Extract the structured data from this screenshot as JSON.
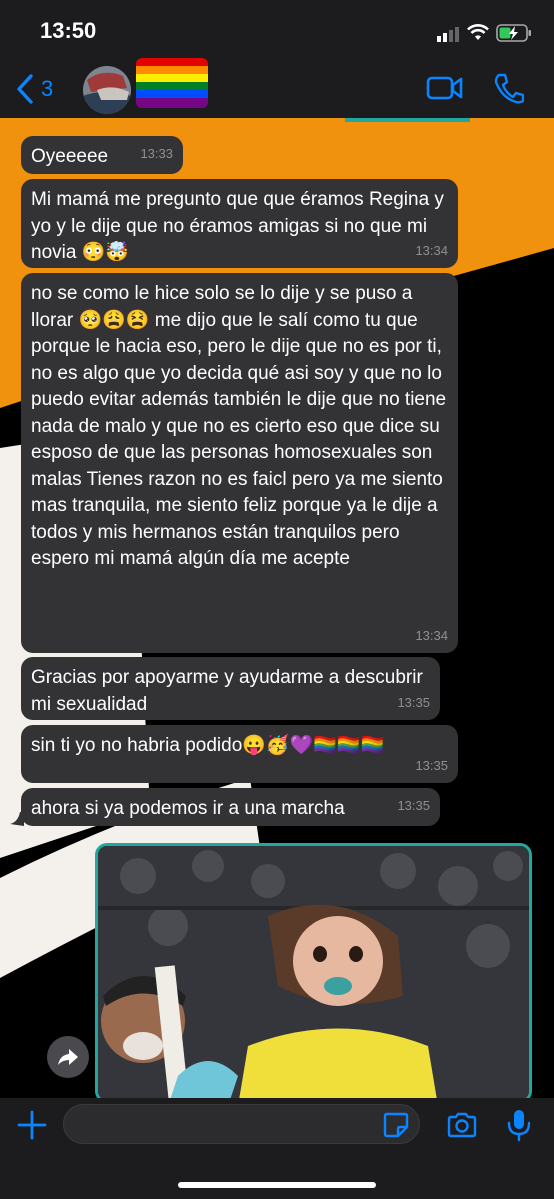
{
  "status": {
    "time": "13:50"
  },
  "header": {
    "back_count": "3"
  },
  "messages": [
    {
      "text": "Oyeeeee",
      "time": "13:33"
    },
    {
      "text": "Mi mamá me pregunto que que éramos Regina y yo y le dije que no éramos amigas si no que mi novia 😳🤯",
      "time": "13:34"
    },
    {
      "text": "no se como le hice solo se lo dije y se puso a llorar 🥺😩😫 me dijo que le salí como tu que porque le hacia eso, pero le dije que no es por ti, no es algo que yo decida qué asi soy y que no lo puedo evitar además también le dije que no tiene nada de malo y que no es cierto eso que dice su esposo de que las personas homosexuales son malas Tienes razon no es faicl pero ya me siento mas tranquila, me siento feliz porque ya le dije a todos y mis hermanos están tranquilos pero espero mi mamá algún día me acepte",
      "time": "13:34"
    },
    {
      "text": "Gracias por apoyarme y ayudarme a descubrir mi sexualidad",
      "time": "13:35"
    },
    {
      "text": "sin ti yo no habria podido😛🥳💜🏳️‍🌈🏳️‍🌈🏳️‍🌈",
      "time": "13:35"
    },
    {
      "text": "ahora si ya podemos ir a una marcha",
      "time": "13:35"
    }
  ],
  "icons": {
    "back": "chevron-left-icon",
    "video": "video-call-icon",
    "phone": "phone-icon",
    "forward": "forward-icon",
    "plus": "plus-icon",
    "sticker": "sticker-icon",
    "camera": "camera-icon",
    "mic": "microphone-icon"
  },
  "colors": {
    "accent": "#0a84ff",
    "bubble": "#333335",
    "wallpaper_orange": "#f0920d"
  }
}
